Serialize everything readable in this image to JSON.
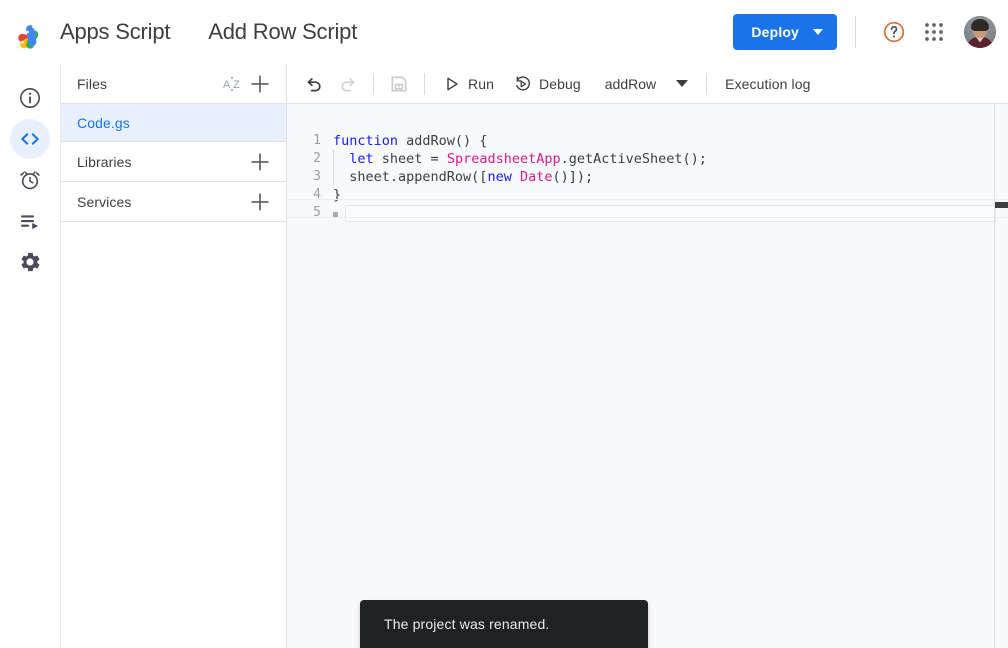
{
  "app": {
    "brand_name": "Apps Script",
    "project_title": "Add Row Script",
    "logo_icon": "apps-script-logo"
  },
  "topbar": {
    "deploy_label": "Deploy",
    "deploy_caret_icon": "chevron-down-icon",
    "deploy_color": "#1a73e8",
    "help_icon": "help-circle-icon",
    "apps_grid_icon": "apps-grid-icon",
    "avatar_icon": "user-avatar"
  },
  "rail": {
    "items": [
      {
        "name": "overview",
        "icon": "info-circle-icon",
        "active": false
      },
      {
        "name": "editor",
        "icon": "code-brackets-icon",
        "active": true
      },
      {
        "name": "triggers",
        "icon": "alarm-clock-icon",
        "active": false
      },
      {
        "name": "executions",
        "icon": "executions-list-icon",
        "active": false
      },
      {
        "name": "settings",
        "icon": "gear-icon",
        "active": false
      }
    ]
  },
  "files_panel": {
    "files_header": {
      "label": "Files",
      "sort_icon": "sort-az-icon",
      "add_icon": "plus-icon"
    },
    "files": [
      {
        "name": "Code.gs",
        "selected": true
      }
    ],
    "libraries_header": {
      "label": "Libraries",
      "add_icon": "plus-icon"
    },
    "services_header": {
      "label": "Services",
      "add_icon": "plus-icon"
    }
  },
  "editor_toolbar": {
    "undo_icon": "undo-arrow-icon",
    "redo_icon": "redo-arrow-icon",
    "save_icon": "save-disk-icon",
    "run_label": "Run",
    "run_icon": "play-triangle-icon",
    "debug_label": "Debug",
    "debug_icon": "debug-step-icon",
    "function_selected": "addRow",
    "function_caret_icon": "caret-down-icon",
    "execution_log_label": "Execution log"
  },
  "code": {
    "language": "javascript",
    "lines": [
      {
        "number": "1",
        "indent_guide": false,
        "tokens": [
          {
            "t": "function ",
            "c": "kw"
          },
          {
            "t": "addRow() {",
            "c": "plain"
          }
        ]
      },
      {
        "number": "2",
        "indent_guide": true,
        "tokens": [
          {
            "t": "  ",
            "c": "plain"
          },
          {
            "t": "let ",
            "c": "kw"
          },
          {
            "t": "sheet = ",
            "c": "plain"
          },
          {
            "t": "SpreadsheetApp",
            "c": "cls"
          },
          {
            "t": ".getActiveSheet();",
            "c": "plain"
          }
        ]
      },
      {
        "number": "3",
        "indent_guide": true,
        "tokens": [
          {
            "t": "  sheet.appendRow([",
            "c": "plain"
          },
          {
            "t": "new ",
            "c": "kw"
          },
          {
            "t": "Date",
            "c": "cls"
          },
          {
            "t": "()]);",
            "c": "plain"
          }
        ]
      },
      {
        "number": "4",
        "indent_guide": false,
        "tokens": [
          {
            "t": "}",
            "c": "plain"
          }
        ]
      },
      {
        "number": "5",
        "indent_guide": false,
        "active": true,
        "tokens": []
      }
    ]
  },
  "toast": {
    "message": "The project was renamed.",
    "background": "#202124"
  }
}
